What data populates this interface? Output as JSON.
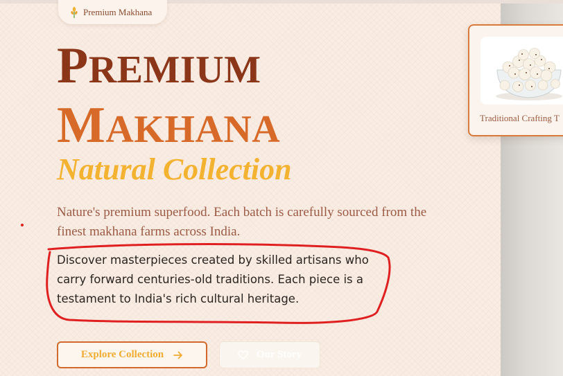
{
  "badge": {
    "icon": "wheat-icon",
    "label": "Premium Makhana"
  },
  "hero": {
    "title_line1": {
      "cap": "P",
      "rest": "REMIUM"
    },
    "title_line2": {
      "cap": "M",
      "rest": "AKHANA"
    },
    "subtitle": "Natural Collection",
    "description": "Nature's premium superfood. Each batch is carefully sourced from the finest makhana farms across India.",
    "description_secondary": "Discover masterpieces created by skilled artisans who carry forward centuries-old traditions. Each piece is a testament to India's rich cultural heritage."
  },
  "buttons": {
    "primary": {
      "label": "Explore Collection",
      "icon": "arrow-right-icon"
    },
    "secondary": {
      "label": "Our Story",
      "icon": "heart-icon"
    }
  },
  "card": {
    "image_alt": "makhana in glass bowl",
    "caption": "Traditional Crafting T"
  },
  "colors": {
    "title_dark": "#8b3519",
    "title_orange": "#d76a28",
    "accent_gold": "#f3b230",
    "annotation_red": "#e02020"
  }
}
